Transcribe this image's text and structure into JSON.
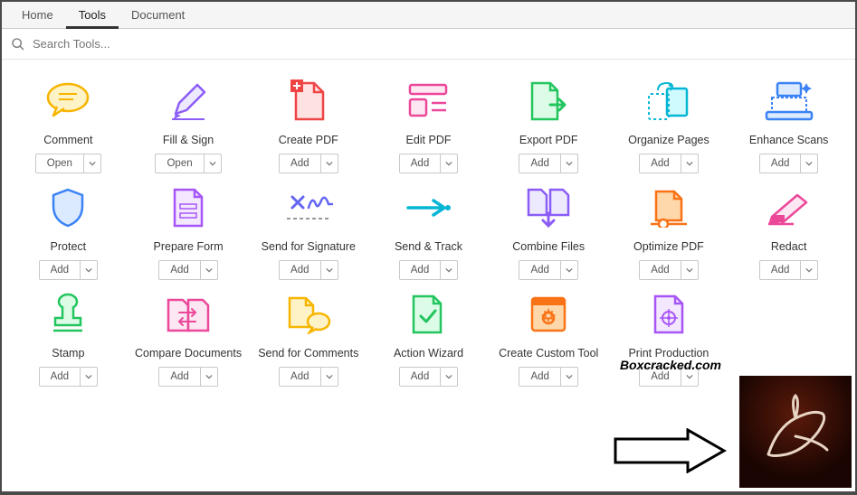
{
  "tabs": {
    "items": [
      "Home",
      "Tools",
      "Document"
    ],
    "active": 1
  },
  "search": {
    "placeholder": "Search Tools..."
  },
  "tools": [
    {
      "label": "Comment",
      "button": "Open",
      "icon": "comment",
      "color": "#f7b500"
    },
    {
      "label": "Fill & Sign",
      "button": "Open",
      "icon": "fillsign",
      "color": "#8b5cf6"
    },
    {
      "label": "Create PDF",
      "button": "Add",
      "icon": "createpdf",
      "color": "#ef4444"
    },
    {
      "label": "Edit PDF",
      "button": "Add",
      "icon": "editpdf",
      "color": "#ec4899"
    },
    {
      "label": "Export PDF",
      "button": "Add",
      "icon": "exportpdf",
      "color": "#22c55e"
    },
    {
      "label": "Organize Pages",
      "button": "Add",
      "icon": "organize",
      "color": "#06b6d4"
    },
    {
      "label": "Enhance Scans",
      "button": "Add",
      "icon": "enhance",
      "color": "#3b82f6"
    },
    {
      "label": "Protect",
      "button": "Add",
      "icon": "protect",
      "color": "#3b82f6"
    },
    {
      "label": "Prepare Form",
      "button": "Add",
      "icon": "prepform",
      "color": "#a855f7"
    },
    {
      "label": "Send for Signature",
      "button": "Add",
      "icon": "signature",
      "color": "#6366f1"
    },
    {
      "label": "Send & Track",
      "button": "Add",
      "icon": "sendtrack",
      "color": "#06b6d4"
    },
    {
      "label": "Combine Files",
      "button": "Add",
      "icon": "combine",
      "color": "#8b5cf6"
    },
    {
      "label": "Optimize PDF",
      "button": "Add",
      "icon": "optimize",
      "color": "#f97316"
    },
    {
      "label": "Redact",
      "button": "Add",
      "icon": "redact",
      "color": "#ec4899"
    },
    {
      "label": "Stamp",
      "button": "Add",
      "icon": "stamp",
      "color": "#22c55e"
    },
    {
      "label": "Compare Documents",
      "button": "Add",
      "icon": "compare",
      "color": "#ec4899"
    },
    {
      "label": "Send for Comments",
      "button": "Add",
      "icon": "sendcomment",
      "color": "#f7b500"
    },
    {
      "label": "Action Wizard",
      "button": "Add",
      "icon": "wizard",
      "color": "#22c55e"
    },
    {
      "label": "Create Custom Tool",
      "button": "Add",
      "icon": "custom",
      "color": "#f97316"
    },
    {
      "label": "Print Production",
      "button": "Add",
      "icon": "printprod",
      "color": "#a855f7"
    }
  ],
  "watermark": "Boxcracked.com"
}
